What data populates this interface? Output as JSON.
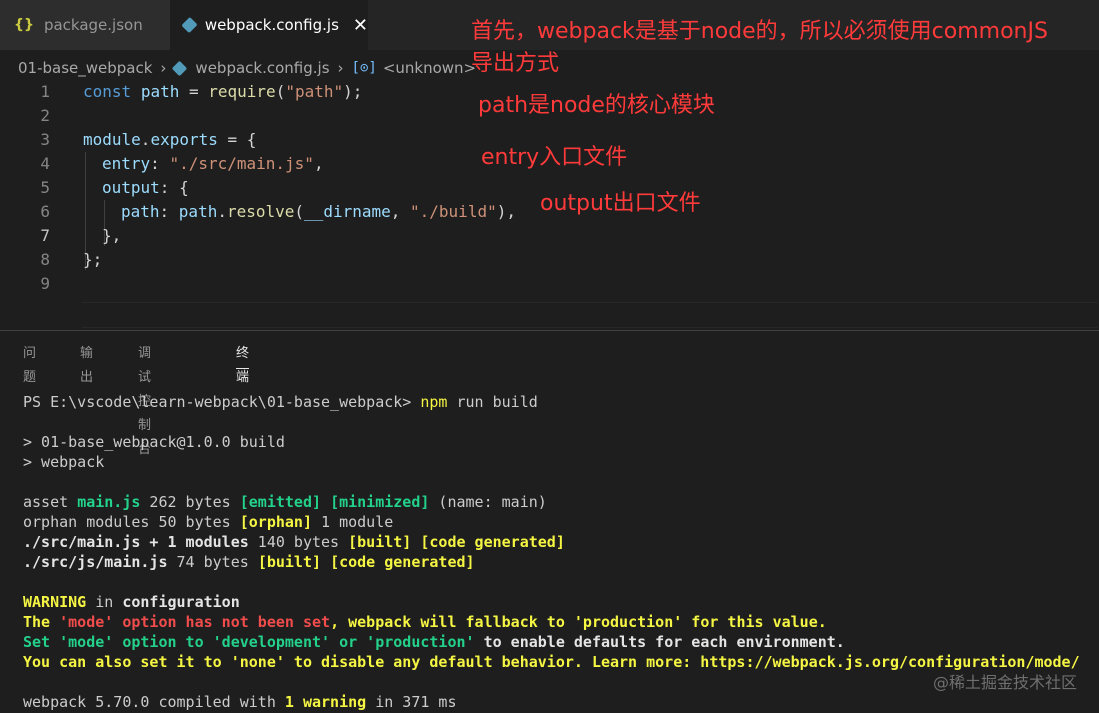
{
  "tabs": [
    {
      "icon": "{}",
      "label": "package.json"
    },
    {
      "label": "webpack.config.js",
      "close": "✕"
    }
  ],
  "breadcrumb": {
    "folder": "01-base_webpack",
    "sep": "›",
    "file": "webpack.config.js",
    "symbol_icon": "[⊙]",
    "symbol": "<unknown>"
  },
  "lines": {
    "n": [
      "1",
      "2",
      "3",
      "4",
      "5",
      "6",
      "7",
      "8",
      "9"
    ],
    "l1": [
      "const",
      " ",
      "path",
      " = ",
      "require",
      "(",
      "\"path\"",
      ");"
    ],
    "l3": [
      "module",
      ".",
      "exports",
      " = {"
    ],
    "l4": [
      "entry",
      ": ",
      "\"./src/main.js\"",
      ","
    ],
    "l5": [
      "output",
      ": {"
    ],
    "l6": [
      "path",
      ": ",
      "path",
      ".",
      "resolve",
      "(",
      "__dirname",
      ", ",
      "\"./build\"",
      "),"
    ],
    "l7": "},",
    "l8": "};"
  },
  "annotations": [
    "首先，webpack是基于node的，所以必须使用commonJS",
    "导出方式",
    "path是node的核心模块",
    "entry入口文件",
    "output出口文件"
  ],
  "panel_tabs": [
    "问题",
    "输出",
    "调试控制台",
    "终端"
  ],
  "terminal": {
    "prompt": "PS E:\\vscode\\learn-webpack\\01-base_webpack> ",
    "cmd1": "npm",
    "cmd2": " run build",
    "l2": "> 01-base_webpack@1.0.0 build",
    "l3": "> webpack",
    "asset": [
      "asset ",
      "main.js",
      " 262 bytes ",
      "[emitted]",
      " ",
      "[minimized]",
      " (name: main)"
    ],
    "orphan": [
      "orphan modules 50 bytes ",
      "[orphan]",
      " 1 module"
    ],
    "built1": [
      "./src/main.js + 1 modules",
      " 140 bytes ",
      "[built]",
      " ",
      "[code generated]"
    ],
    "built2": [
      "./src/js/main.js",
      " 74 bytes ",
      "[built]",
      " ",
      "[code generated]"
    ],
    "warn": [
      "WARNING",
      " in ",
      "configuration"
    ],
    "w1": [
      "The ",
      "'mode' option has not been set",
      ", webpack will fallback to 'production' for this value."
    ],
    "w2": [
      "Set 'mode' option to 'development' or 'production'",
      " to enable defaults for each environment."
    ],
    "w3": "You can also set it to 'none' to disable any default behavior. Learn more: https://webpack.js.org/configuration/mode/",
    "final": [
      "webpack 5.70.0 compiled with ",
      "1 warning",
      " in 371 ms"
    ]
  },
  "watermark": "@稀土掘金技术社区",
  "colors": {
    "annotation": "#ff3a3a",
    "keyword": "#569cd6",
    "string": "#ce9178",
    "green": "#23d18b",
    "yellow": "#f5f543",
    "red": "#f14c4c"
  }
}
